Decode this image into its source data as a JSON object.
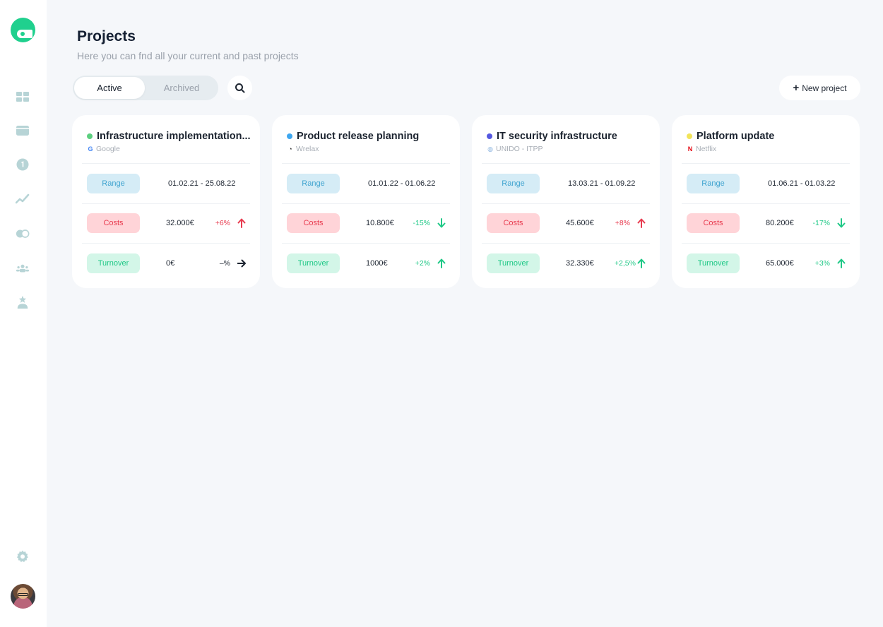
{
  "sidebar": {
    "logo": "eye-mask-logo",
    "nav": [
      {
        "icon": "dashboard-grid-icon"
      },
      {
        "icon": "card-icon"
      },
      {
        "icon": "info-coin-icon"
      },
      {
        "icon": "trend-line-icon"
      },
      {
        "icon": "toggle-icon"
      },
      {
        "icon": "team-icon"
      },
      {
        "icon": "user-star-icon"
      }
    ],
    "settings_icon": "gear-icon",
    "avatar": "user-avatar"
  },
  "header": {
    "title": "Projects",
    "subtitle": "Here you can fnd all your current and past projects"
  },
  "toolbar": {
    "tabs": [
      {
        "label": "Active",
        "selected": true
      },
      {
        "label": "Archived",
        "selected": false
      }
    ],
    "search_icon": "search-icon",
    "new_project_plus": "+",
    "new_project_label": "New project"
  },
  "colors": {
    "accent": "#20d08e",
    "range_bg": "#d5ecf6",
    "costs_bg": "#ffd4d8",
    "turnover_bg": "#d3f6e8",
    "up_bad": "#e83b4f",
    "good": "#1ec886"
  },
  "labels": {
    "range": "Range",
    "costs": "Costs",
    "turnover": "Turnover"
  },
  "projects": [
    {
      "title": "Infrastructure implementation...",
      "dot_color": "#5ccf7f",
      "client": "Google",
      "client_logo": "G",
      "range": "01.02.21 - 25.08.22",
      "costs": {
        "value": "32.000€",
        "change": "+6%",
        "trend": "up"
      },
      "turnover": {
        "value": "0€",
        "change": "–%",
        "trend": "flat"
      }
    },
    {
      "title": "Product release planning",
      "dot_color": "#3ea7f0",
      "client": "Wrelax",
      "client_logo": "◔",
      "range": "01.01.22 - 01.06.22",
      "costs": {
        "value": "10.800€",
        "change": "-15%",
        "trend": "down"
      },
      "turnover": {
        "value": "1000€",
        "change": "+2%",
        "trend": "up"
      }
    },
    {
      "title": "IT security infrastructure",
      "dot_color": "#5558e0",
      "client": "UNIDO - ITPP",
      "client_logo": "◍",
      "range": "13.03.21 - 01.09.22",
      "costs": {
        "value": "45.600€",
        "change": "+8%",
        "trend": "up"
      },
      "turnover": {
        "value": "32.330€",
        "change": "+2,5%",
        "trend": "up"
      }
    },
    {
      "title": "Platform update",
      "dot_color": "#f2e45a",
      "client": "Netflix",
      "client_logo": "N",
      "range": "01.06.21 - 01.03.22",
      "costs": {
        "value": "80.200€",
        "change": "-17%",
        "trend": "down"
      },
      "turnover": {
        "value": "65.000€",
        "change": "+3%",
        "trend": "up"
      }
    }
  ]
}
